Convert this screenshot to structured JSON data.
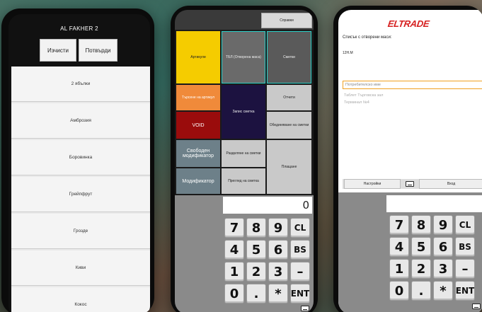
{
  "phone1": {
    "title": "AL FAKHER 2",
    "clear_label": "Изчисти",
    "confirm_label": "Потвърди",
    "items": [
      "2 ябълки",
      "Амброзия",
      "Боровинка",
      "Грейпфрут",
      "Грозде",
      "Киви",
      "Кокос"
    ]
  },
  "phone2": {
    "top_button": "Справки",
    "tiles": {
      "articles": "Артикули",
      "open_table": "ТБЛ (Отворена маса)",
      "receipts": "Сметки",
      "print_article": "Търсене на артикул",
      "save_bill": "Запис сметка",
      "open": "Отчети",
      "merge_bills": "Обединяване на сметки",
      "void": "VOID",
      "free_modifier": "Свободен модификатор",
      "split_bill": "Разделяне на сметки",
      "payment": "Плащане",
      "modifier": "Модификатор",
      "bill_preview": "Преглед на сметка"
    },
    "display_value": "0",
    "keys": [
      "7",
      "8",
      "9",
      "CL",
      "4",
      "5",
      "6",
      "BS",
      "1",
      "2",
      "3",
      "–",
      "0",
      ".",
      "*",
      "ENT"
    ]
  },
  "phone3": {
    "logo": "ELTRADE",
    "header": "Списък с отворени маси:",
    "table": "12Н.М",
    "username_placeholder": "Потребителско име",
    "hint1": "Таблет Търговска зал",
    "hint2": "Терминал №4",
    "settings_label": "Настройки",
    "login_label": "Вход",
    "keys": [
      "7",
      "8",
      "9",
      "CL",
      "4",
      "5",
      "6",
      "BS",
      "1",
      "2",
      "3",
      "–",
      "0",
      ".",
      "*",
      "ENT"
    ]
  },
  "colors": {
    "yellow": "#f5cc00",
    "gray_tile": "#6a6a6a",
    "orange": "#f08a3a",
    "navy": "#1c1240",
    "red": "#9a0c0c",
    "slate": "#6d8089",
    "light_tile": "#c9c9c9",
    "eltrade_red": "#d62020"
  }
}
